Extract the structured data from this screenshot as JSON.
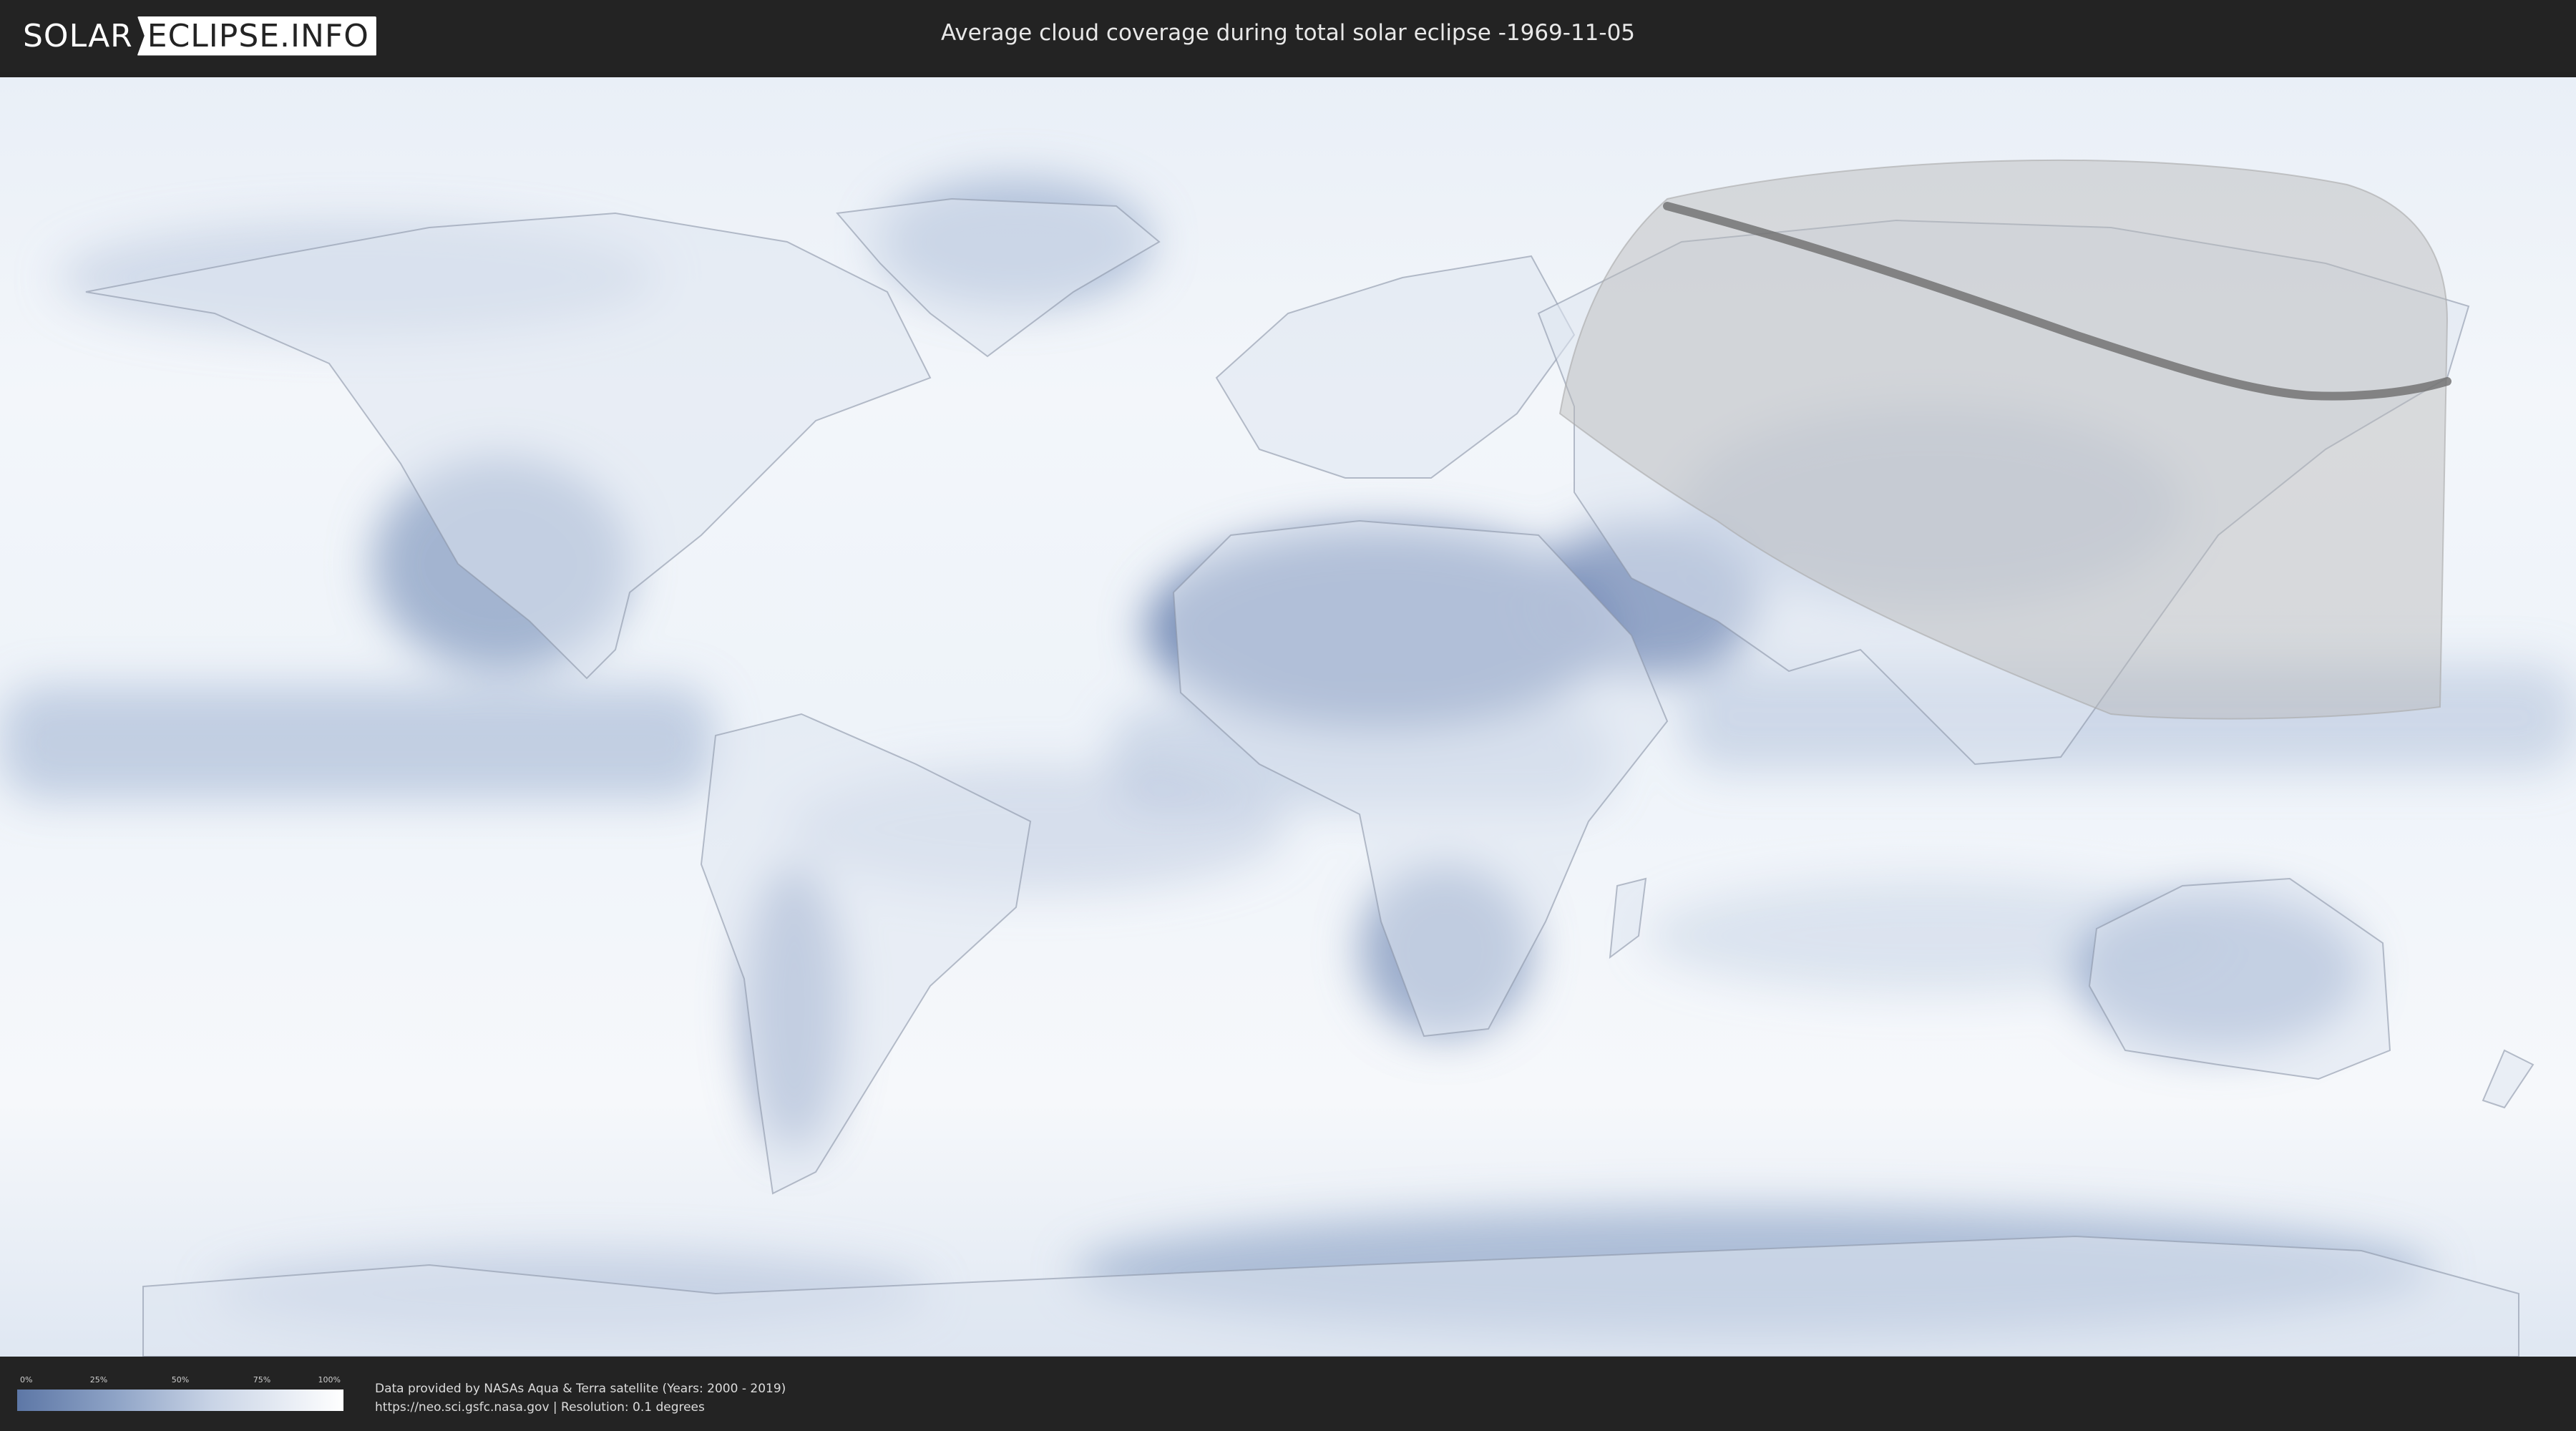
{
  "header": {
    "logo_part1": "SOLAR",
    "logo_part2": "ECLIPSE.INFO",
    "title": "Average cloud coverage during total solar eclipse -1969-11-05"
  },
  "colors": {
    "header_bg": "#232323",
    "clear_sky": "#5d77a6",
    "full_cloud": "#ffffff",
    "shadow_overlay": "#bdbdbd",
    "eclipse_path": "#6e6e6e"
  },
  "legend": {
    "labels": [
      "0%",
      "25%",
      "50%",
      "75%",
      "100%"
    ],
    "stops": [
      0,
      0.25,
      0.5,
      0.75,
      1.0
    ]
  },
  "footer": {
    "line1": "Data provided by NASAs Aqua & Terra satellite (Years: 2000 - 2019)",
    "line2": "https://neo.sci.gsfc.nasa.gov | Resolution: 0.1 degrees"
  }
}
